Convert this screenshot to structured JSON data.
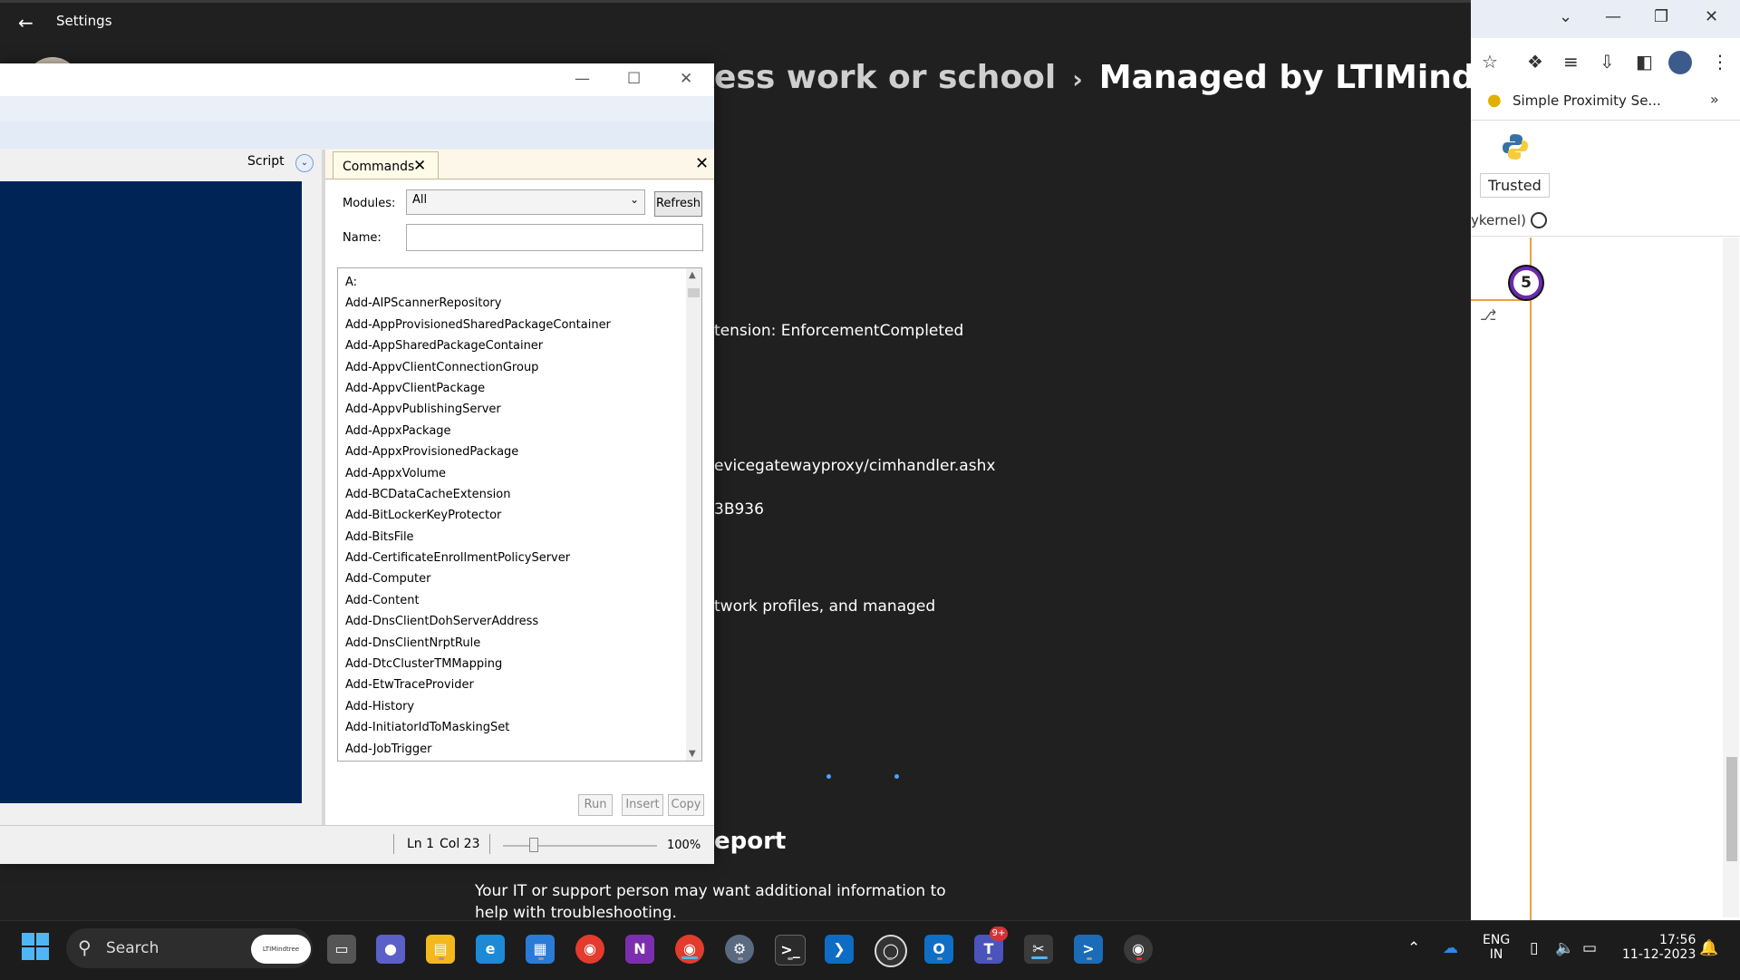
{
  "settings": {
    "title": "Settings",
    "breadcrumb": {
      "part1": "ess work or school",
      "part2": "Managed by LTIMindtree"
    },
    "info_lines": [
      "tension: EnforcementCompleted",
      "evicegatewayproxy/cimhandler.ashx",
      "3B936",
      "twork profiles, and managed"
    ],
    "section_heading": "eport",
    "help_text": "Your IT or support person may want additional information to help with troubleshooting."
  },
  "browser": {
    "bookmark_label": "Simple Proximity Se...",
    "trusted_label": "Trusted",
    "kernel_label": "ykernel)",
    "cell_badge": "5"
  },
  "ise": {
    "script_tab_label": "Script",
    "commands_tab_label": "Commands",
    "modules_label": "Modules:",
    "modules_value": "All",
    "refresh_label": "Refresh",
    "name_label": "Name:",
    "name_value": "",
    "commands": [
      "A:",
      "Add-AIPScannerRepository",
      "Add-AppProvisionedSharedPackageContainer",
      "Add-AppSharedPackageContainer",
      "Add-AppvClientConnectionGroup",
      "Add-AppvClientPackage",
      "Add-AppvPublishingServer",
      "Add-AppxPackage",
      "Add-AppxProvisionedPackage",
      "Add-AppxVolume",
      "Add-BCDataCacheExtension",
      "Add-BitLockerKeyProtector",
      "Add-BitsFile",
      "Add-CertificateEnrollmentPolicyServer",
      "Add-Computer",
      "Add-Content",
      "Add-DnsClientDohServerAddress",
      "Add-DnsClientNrptRule",
      "Add-DtcClusterTMMapping",
      "Add-EtwTraceProvider",
      "Add-History",
      "Add-InitiatorIdToMaskingSet",
      "Add-JobTrigger"
    ],
    "run_label": "Run",
    "insert_label": "Insert",
    "copy_label": "Copy",
    "status_line": "Ln 1",
    "status_col": "Col 23",
    "zoom": "100%"
  },
  "taskbar": {
    "search_label": "Search",
    "search_badge": "LTIMindtree",
    "apps": [
      "file-explorer",
      "edge",
      "microsoft-store",
      "chrome",
      "onenote",
      "chrome-profile",
      "settings",
      "terminal",
      "vscode",
      "github-desktop",
      "outlook-new",
      "teams-new",
      "snipping-tool",
      "powershell-ise",
      "recorder"
    ],
    "teams_badge": "9+",
    "language_line1": "ENG",
    "language_line2": "IN",
    "time": "17:56",
    "date": "11-12-2023"
  }
}
